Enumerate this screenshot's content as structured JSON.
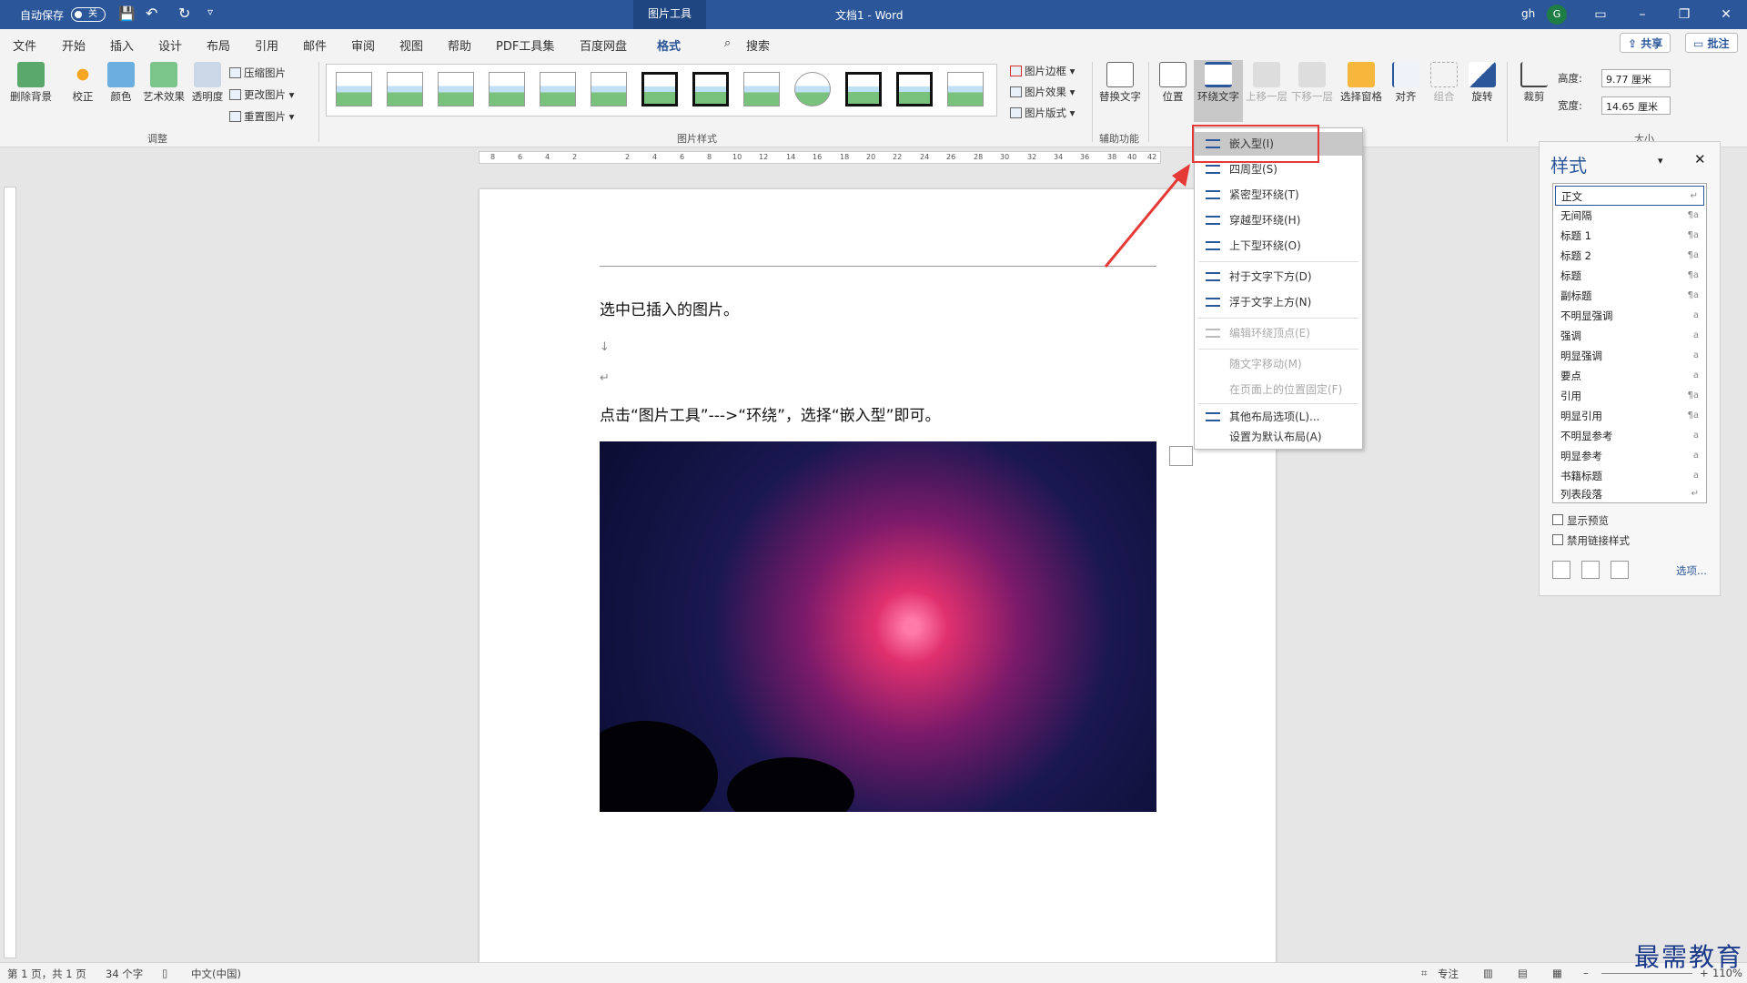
{
  "titlebar": {
    "autosave_label": "自动保存",
    "autosave_state": "关",
    "contextual_tab": "图片工具",
    "doc_title": "文档1 - Word",
    "user_initial": "gh",
    "avatar_letter": "G"
  },
  "tabs": [
    "文件",
    "开始",
    "插入",
    "设计",
    "布局",
    "引用",
    "邮件",
    "审阅",
    "视图",
    "帮助",
    "PDF工具集",
    "百度网盘",
    "格式",
    "搜索"
  ],
  "share_label": "共享",
  "comment_label": "批注",
  "ribbon": {
    "adjust": {
      "remove_bg": "删除背景",
      "correct": "校正",
      "color": "颜色",
      "artistic": "艺术效果",
      "transparency": "透明度",
      "compress": "压缩图片",
      "change": "更改图片",
      "reset": "重置图片",
      "group": "调整"
    },
    "styles_group": "图片样式",
    "border": "图片边框",
    "effects": "图片效果",
    "layout": "图片版式",
    "alt_text": "替换文字",
    "accessibility_group": "辅助功能",
    "position": "位置",
    "wrap_text": "环绕文字",
    "bring_forward": "上移一层",
    "send_backward": "下移一层",
    "selection_pane": "选择窗格",
    "align": "对齐",
    "group": "组合",
    "rotate": "旋转",
    "crop": "裁剪",
    "height_label": "高度:",
    "height_value": "9.77 厘米",
    "width_label": "宽度:",
    "width_value": "14.65 厘米",
    "size_group": "大小"
  },
  "doc": {
    "line1": "选中已插入的图片。",
    "line2": "点击“图片工具”--->“环绕”，选择“嵌入型”即可。",
    "para_mark": "↵",
    "down_arrow": "↓"
  },
  "ruler_labels": [
    "8",
    "6",
    "4",
    "2",
    "2",
    "4",
    "6",
    "8",
    "10",
    "12",
    "14",
    "16",
    "18",
    "20",
    "22",
    "24",
    "26",
    "28",
    "30",
    "32",
    "34",
    "36",
    "38",
    "40",
    "42"
  ],
  "wrap_menu": [
    {
      "label": "嵌入型(I)",
      "highlight": true,
      "disabled": false
    },
    {
      "label": "四周型(S)",
      "highlight": false,
      "disabled": false
    },
    {
      "label": "紧密型环绕(T)",
      "highlight": false,
      "disabled": false
    },
    {
      "label": "穿越型环绕(H)",
      "highlight": false,
      "disabled": false
    },
    {
      "label": "上下型环绕(O)",
      "highlight": false,
      "disabled": false
    },
    {
      "label": "衬于文字下方(D)",
      "highlight": false,
      "disabled": false
    },
    {
      "label": "浮于文字上方(N)",
      "highlight": false,
      "disabled": false
    },
    {
      "label": "编辑环绕顶点(E)",
      "highlight": false,
      "disabled": true
    },
    {
      "label": "随文字移动(M)",
      "highlight": false,
      "disabled": true
    },
    {
      "label": "在页面上的位置固定(F)",
      "highlight": false,
      "disabled": true
    },
    {
      "label": "其他布局选项(L)...",
      "highlight": false,
      "disabled": false
    },
    {
      "label": "设置为默认布局(A)",
      "highlight": false,
      "disabled": false
    }
  ],
  "styles_pane": {
    "title": "样式",
    "items": [
      {
        "name": "正文",
        "mark": "↵"
      },
      {
        "name": "无间隔",
        "mark": "¶a"
      },
      {
        "name": "标题 1",
        "mark": "¶a"
      },
      {
        "name": "标题 2",
        "mark": "¶a"
      },
      {
        "name": "标题",
        "mark": "¶a"
      },
      {
        "name": "副标题",
        "mark": "¶a"
      },
      {
        "name": "不明显强调",
        "mark": "a"
      },
      {
        "name": "强调",
        "mark": "a"
      },
      {
        "name": "明显强调",
        "mark": "a"
      },
      {
        "name": "要点",
        "mark": "a"
      },
      {
        "name": "引用",
        "mark": "¶a"
      },
      {
        "name": "明显引用",
        "mark": "¶a"
      },
      {
        "name": "不明显参考",
        "mark": "a"
      },
      {
        "name": "明显参考",
        "mark": "a"
      },
      {
        "name": "书籍标题",
        "mark": "a"
      },
      {
        "name": "列表段落",
        "mark": "↵"
      }
    ],
    "show_preview": "显示预览",
    "disable_linked": "禁用链接样式",
    "options": "选项..."
  },
  "statusbar": {
    "page": "第 1 页，共 1 页",
    "words": "34 个字",
    "lang": "中文(中国)",
    "focus": "专注",
    "zoom": "110%"
  },
  "watermark": "最需教育",
  "colors": {
    "brand": "#2b579a",
    "highlight_box": "#e53935"
  }
}
